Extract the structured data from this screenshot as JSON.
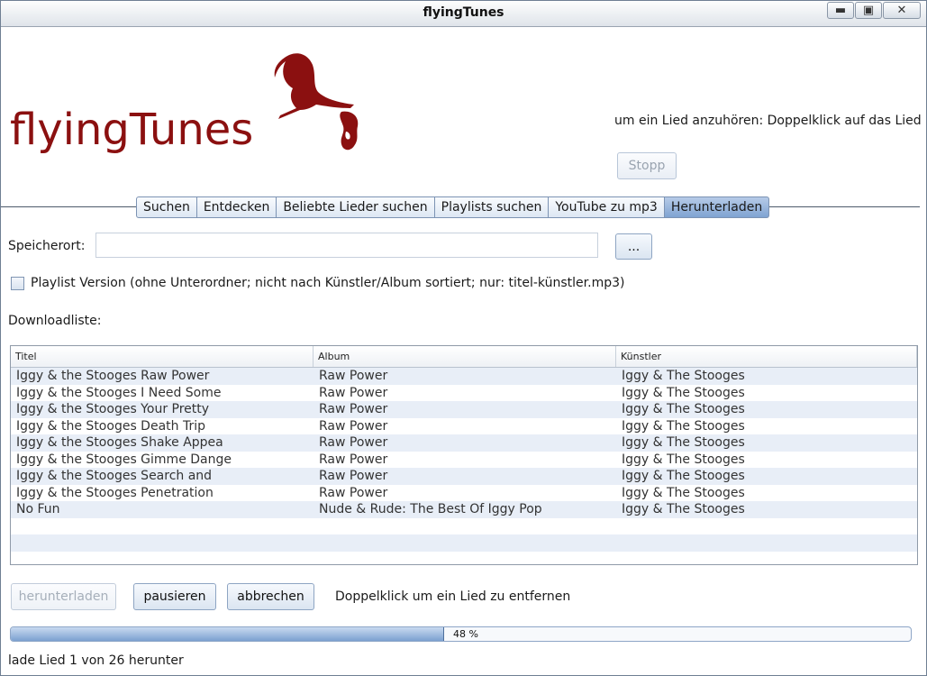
{
  "window": {
    "title": "flyingTunes",
    "minimize_label": "▬",
    "maximize_label": "▣",
    "close_label": "✕"
  },
  "logo": {
    "text": "flyingTunes",
    "brand_color": "#8b1010"
  },
  "player": {
    "hint": "um ein Lied anzuhören: Doppelklick auf das Lied",
    "stop_label": "Stopp"
  },
  "tabs": [
    {
      "label": "Suchen",
      "active": false
    },
    {
      "label": "Entdecken",
      "active": false
    },
    {
      "label": "Beliebte Lieder suchen",
      "active": false
    },
    {
      "label": "Playlists suchen",
      "active": false
    },
    {
      "label": "YouTube zu mp3",
      "active": false
    },
    {
      "label": "Herunterladen",
      "active": true
    }
  ],
  "download": {
    "location_label": "Speicherort:",
    "location_value": "",
    "browse_label": "...",
    "playlist_checkbox_label": "Playlist Version (ohne Unterordner; nicht nach Künstler/Album sortiert; nur: titel-künstler.mp3)",
    "playlist_checked": false,
    "list_label": "Downloadliste:",
    "columns": [
      "Titel",
      "Album",
      "Künstler"
    ],
    "rows": [
      [
        "Iggy & the Stooges Raw Power",
        "Raw Power",
        "Iggy & The Stooges"
      ],
      [
        "Iggy & the Stooges I Need Some",
        "Raw Power",
        "Iggy & The Stooges"
      ],
      [
        "Iggy & the Stooges Your Pretty",
        "Raw Power",
        "Iggy & The Stooges"
      ],
      [
        "Iggy & the Stooges Death Trip",
        "Raw Power",
        "Iggy & The Stooges"
      ],
      [
        "Iggy & the Stooges Shake Appea",
        "Raw Power",
        "Iggy & The Stooges"
      ],
      [
        "Iggy & the Stooges Gimme Dange",
        "Raw Power",
        "Iggy & The Stooges"
      ],
      [
        "Iggy & the Stooges Search and",
        "Raw Power",
        "Iggy & The Stooges"
      ],
      [
        "Iggy & the Stooges Penetration",
        "Raw Power",
        "Iggy & The Stooges"
      ],
      [
        "No Fun",
        "Nude & Rude: The Best Of Iggy Pop",
        "Iggy & The Stooges"
      ]
    ],
    "empty_rows": 3,
    "download_button": "herunterladen",
    "pause_button": "pausieren",
    "cancel_button": "abbrechen",
    "remove_hint": "Doppelklick um ein Lied zu entfernen",
    "progress_percent": 48,
    "progress_text": "48 %",
    "status": "lade Lied 1 von 26 herunter"
  }
}
